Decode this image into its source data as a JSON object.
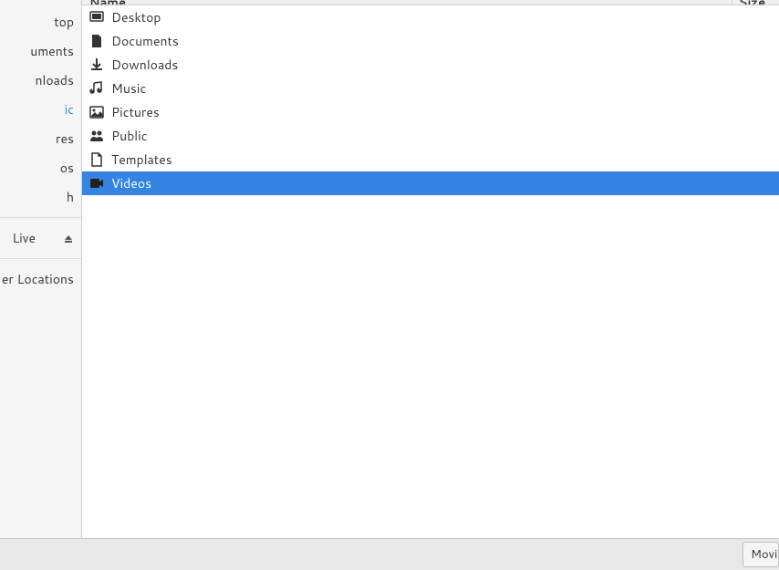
{
  "sidebar": {
    "items": [
      {
        "label": "top"
      },
      {
        "label": "uments"
      },
      {
        "label": "nloads"
      },
      {
        "label": "ic",
        "active": true
      },
      {
        "label": "res"
      },
      {
        "label": "os"
      },
      {
        "label": "h"
      }
    ],
    "mount": {
      "label": "Live"
    },
    "other": {
      "label": "er Locations"
    }
  },
  "header": {
    "name_col": "Name",
    "size_col": "Size"
  },
  "files": [
    {
      "name": "Desktop",
      "icon": "desktop-icon"
    },
    {
      "name": "Documents",
      "icon": "document-icon"
    },
    {
      "name": "Downloads",
      "icon": "download-icon"
    },
    {
      "name": "Music",
      "icon": "music-icon"
    },
    {
      "name": "Pictures",
      "icon": "picture-icon"
    },
    {
      "name": "Public",
      "icon": "public-icon"
    },
    {
      "name": "Templates",
      "icon": "template-icon"
    },
    {
      "name": "Videos",
      "icon": "video-icon",
      "selected": true
    }
  ],
  "bottom": {
    "filter_label": "Movies"
  }
}
